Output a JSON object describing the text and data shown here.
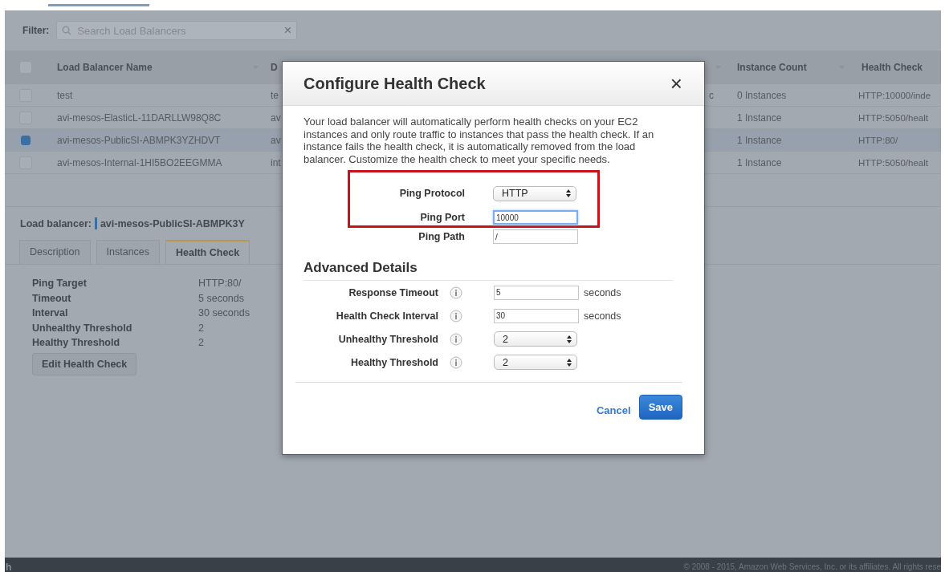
{
  "filter": {
    "label": "Filter:",
    "placeholder": "Search Load Balancers",
    "clear": "×"
  },
  "table": {
    "select_all": {
      "checked": false
    },
    "columns": [
      "Load Balancer Name",
      "D",
      "",
      "Instance Count",
      "Health Check"
    ],
    "rows": [
      {
        "selected": false,
        "cells": [
          "test",
          "te",
          "c",
          "0 Instances",
          "HTTP:10000/inde"
        ]
      },
      {
        "selected": false,
        "cells": [
          "avi-mesos-ElasticL-11DARLLW98Q8C",
          "av",
          "",
          "1 Instance",
          "HTTP:5050/healt"
        ]
      },
      {
        "selected": true,
        "cells": [
          "avi-mesos-PublicSI-ABMPK3YZHDVT",
          "av",
          "",
          "1 Instance",
          "HTTP:80/"
        ]
      },
      {
        "selected": false,
        "cells": [
          "avi-mesos-Internal-1HI5BO2EEGMMA",
          "int",
          "",
          "1 Instance",
          "HTTP:5050/healt"
        ]
      }
    ]
  },
  "detail": {
    "label": "Load balancer:",
    "name": "avi-mesos-PublicSI-ABMPK3Y",
    "tabs": [
      {
        "label": "Description",
        "selected": false
      },
      {
        "label": "Instances",
        "selected": false
      },
      {
        "label": "Health Check",
        "selected": true
      }
    ],
    "fields": [
      {
        "label": "Ping Target",
        "value": "HTTP:80/"
      },
      {
        "label": "Timeout",
        "value": "5 seconds"
      },
      {
        "label": "Interval",
        "value": "30 seconds"
      },
      {
        "label": "Unhealthy Threshold",
        "value": "2"
      },
      {
        "label": "Healthy Threshold",
        "value": "2"
      }
    ],
    "button": "Edit Health Check"
  },
  "modal": {
    "title": "Configure Health Check",
    "close": "×",
    "intro": "Your load balancer will automatically perform health checks on your EC2 instances and only route traffic to instances that pass the health check. If an instance fails the health check, it is automatically removed from the load balancer. Customize the health check to meet your specific needs.",
    "highlighted": [
      {
        "label": "Ping Protocol",
        "kind": "select",
        "value": "HTTP",
        "focused": false
      },
      {
        "label": "Ping Port",
        "kind": "input",
        "value": "10000",
        "focused": true
      }
    ],
    "basic": [
      {
        "label": "Ping Path",
        "kind": "input",
        "value": "/",
        "focused": false
      }
    ],
    "advanced_title": "Advanced Details",
    "advanced": [
      {
        "label": "Response Timeout",
        "kind": "input",
        "value": "5",
        "unit": "seconds"
      },
      {
        "label": "Health Check Interval",
        "kind": "input",
        "value": "30",
        "unit": "seconds"
      },
      {
        "label": "Unhealthy Threshold",
        "kind": "select",
        "value": "2"
      },
      {
        "label": "Healthy Threshold",
        "kind": "select",
        "value": "2"
      }
    ],
    "cancel": "Cancel",
    "save": "Save"
  },
  "footer": {
    "left": "h",
    "copyright": "© 2008 - 2015, Amazon Web Services, Inc. or its affiliates. All rights rese"
  }
}
